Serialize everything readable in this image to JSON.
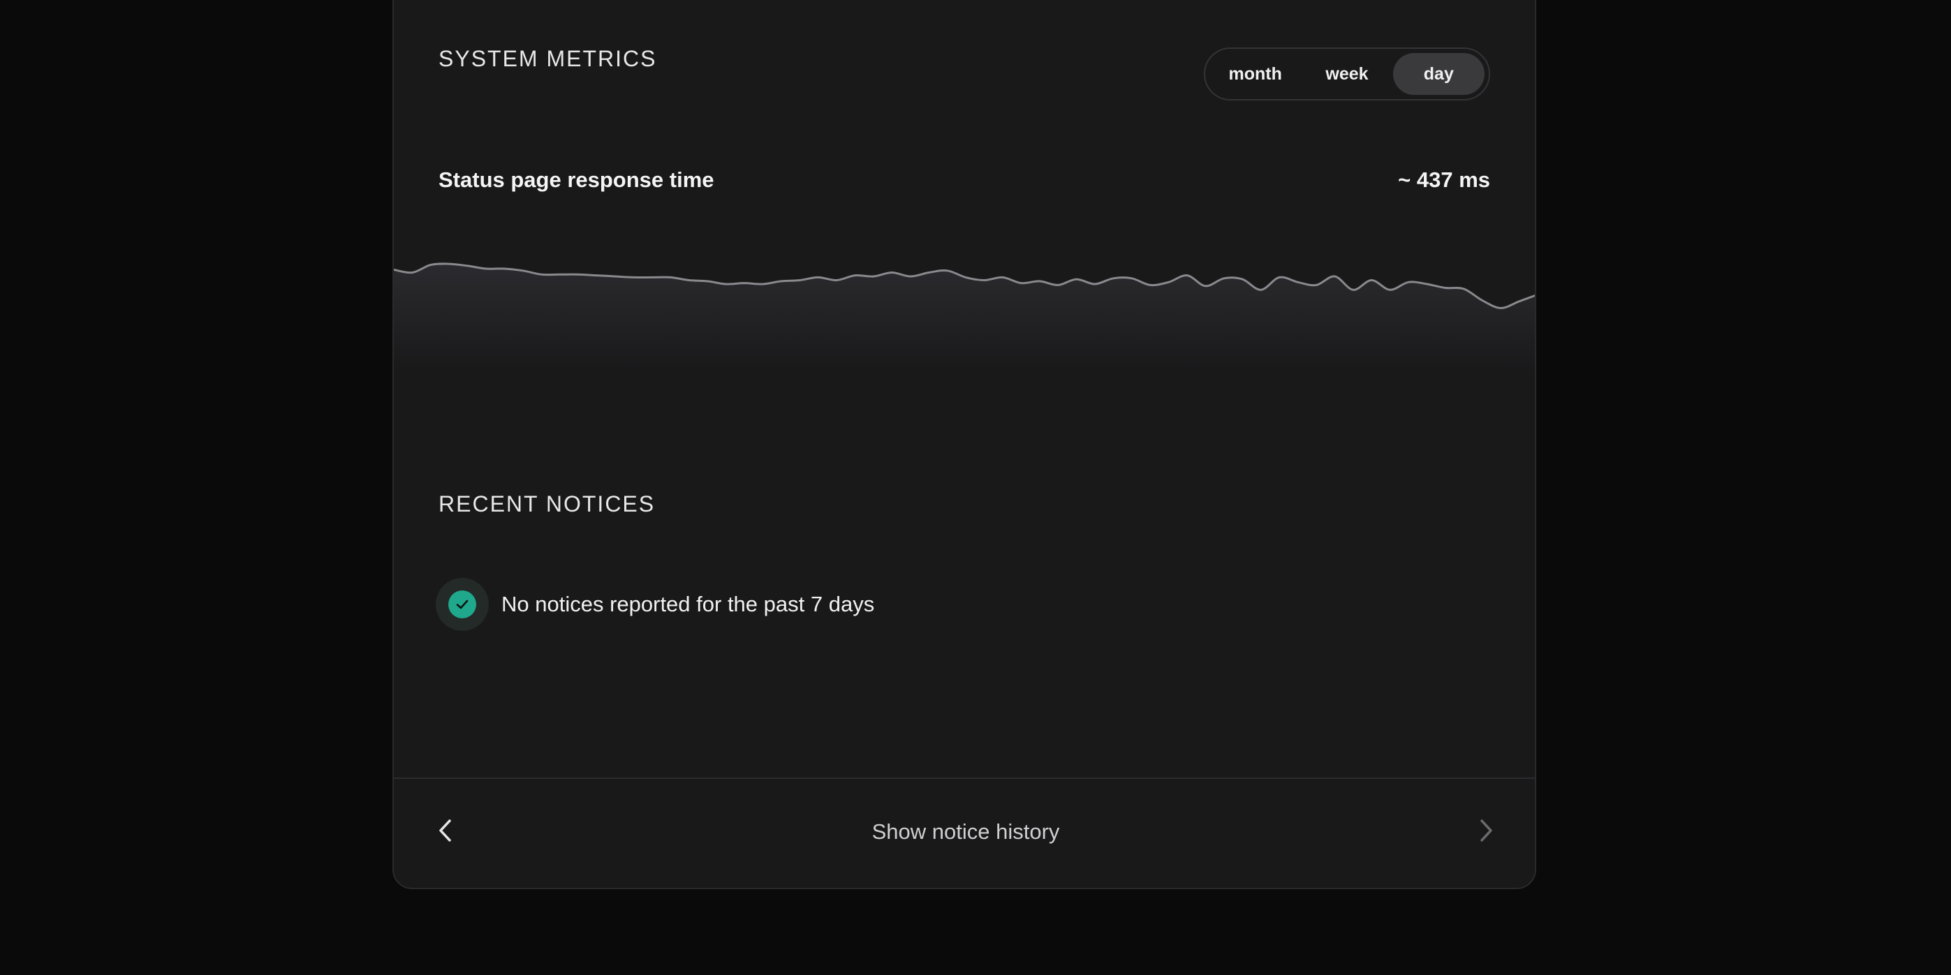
{
  "metrics": {
    "title": "SYSTEM METRICS",
    "range_options": [
      "month",
      "week",
      "day"
    ],
    "selected_range": "day",
    "metric_label": "Status page response time",
    "metric_value": "~ 437 ms"
  },
  "notices": {
    "title": "RECENT NOTICES",
    "message": "No notices reported for the past 7 days",
    "icon": "check-circle-icon",
    "status_color": "#1fa88c"
  },
  "footer": {
    "history_link": "Show notice history",
    "prev_icon": "chevron-left-icon",
    "next_icon": "chevron-right-icon"
  },
  "chart_data": {
    "type": "area",
    "y": [
      435,
      432,
      440,
      441,
      439,
      436,
      436,
      434,
      430,
      430,
      430,
      429,
      428,
      427,
      427,
      427,
      424,
      423,
      420,
      421,
      420,
      423,
      424,
      427,
      424,
      429,
      428,
      432,
      428,
      432,
      434,
      427,
      424,
      427,
      421,
      423,
      419,
      425,
      420,
      426,
      426,
      419,
      422,
      429,
      418,
      426,
      425,
      414,
      427,
      422,
      419,
      428,
      414,
      424,
      414,
      422,
      420,
      416,
      415,
      403,
      395,
      402,
      409
    ],
    "colors": {
      "line": "#8a8a8e",
      "fill_top": "#2b2b2f",
      "fill_bottom": "#19191a"
    }
  }
}
